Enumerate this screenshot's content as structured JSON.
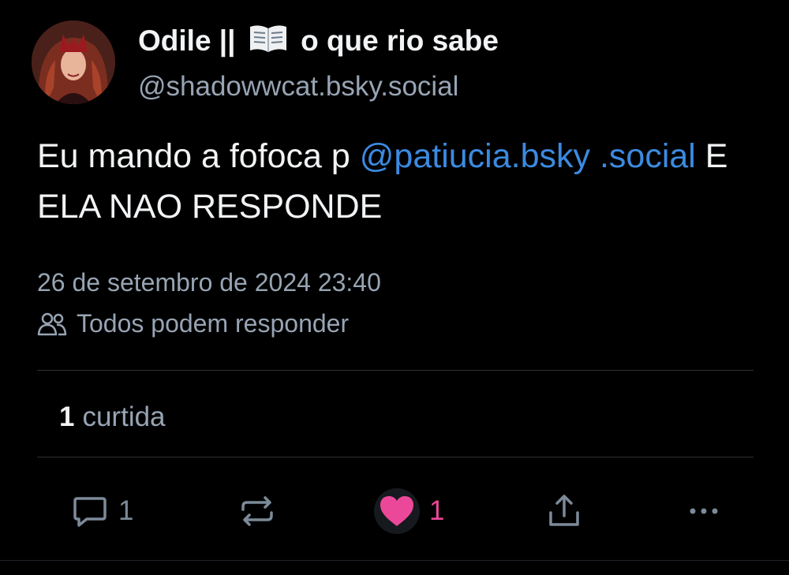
{
  "author": {
    "name_prefix": "Odile ||",
    "name_suffix": "o que rio sabe",
    "book_icon": "open-book-icon",
    "handle": "@shadowwcat.bsky.social"
  },
  "post": {
    "text_before": "Eu mando a fofoca p ",
    "mention": "@patiucia.bsky .social",
    "text_after": " E ELA NAO RESPONDE"
  },
  "meta": {
    "timestamp": "26 de setembro de 2024 23:40",
    "reply_setting": "Todos podem responder"
  },
  "stats": {
    "likes_count": "1",
    "likes_label": "curtida"
  },
  "actions": {
    "reply_count": "1",
    "like_count": "1"
  },
  "colors": {
    "background": "#000000",
    "mention": "#3c8ae0",
    "like": "#ec4899",
    "muted": "#97a4b3"
  }
}
